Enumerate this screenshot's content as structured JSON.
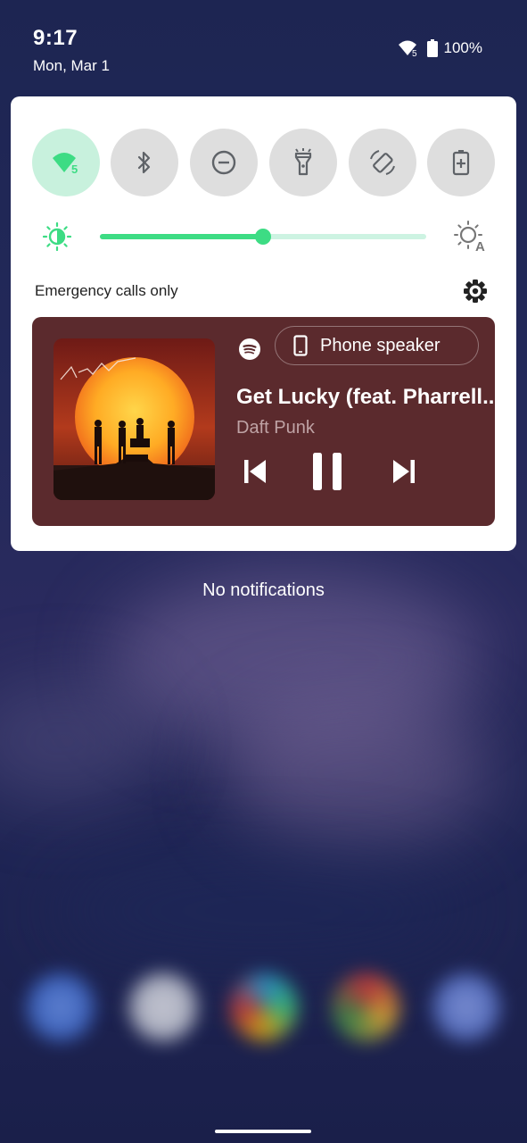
{
  "status_bar": {
    "time": "9:17",
    "date": "Mon, Mar 1",
    "wifi_badge": "5",
    "battery": "100%"
  },
  "quick_settings": {
    "tiles": [
      {
        "name": "wifi-icon",
        "badge": "5",
        "active": true
      },
      {
        "name": "bluetooth-icon",
        "active": false
      },
      {
        "name": "do-not-disturb-icon",
        "active": false
      },
      {
        "name": "flashlight-icon",
        "active": false
      },
      {
        "name": "auto-rotate-icon",
        "active": false
      },
      {
        "name": "battery-saver-icon",
        "active": false
      }
    ],
    "brightness_level": 0.5,
    "auto_brightness_letter": "A",
    "carrier_text": "Emergency calls only"
  },
  "media": {
    "album_script": "Get Lucky",
    "output_device": "Phone speaker",
    "title": "Get Lucky (feat. Pharrell...",
    "artist": "Daft Punk",
    "app_icon": "spotify-icon"
  },
  "notifications": {
    "empty_text": "No notifications"
  },
  "colors": {
    "accent": "#3ddc84",
    "tile_active": "#c8f1dd",
    "tile_inactive": "#dedede",
    "media_bg": "#5b2a2d"
  }
}
